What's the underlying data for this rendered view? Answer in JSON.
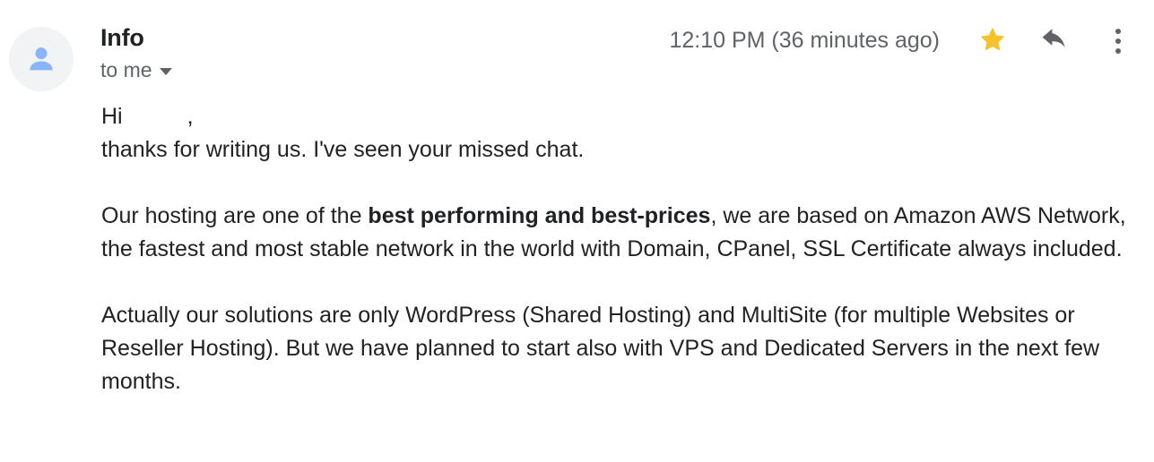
{
  "header": {
    "sender_name": "Info",
    "recipient": "to me",
    "recipient_caret_icon": "chevron-down-icon",
    "timestamp": "12:10 PM (36 minutes ago)",
    "avatar_icon": "person-avatar-icon",
    "actions": {
      "star": {
        "icon": "star-icon",
        "state": "starred",
        "color": "#f4c22b"
      },
      "reply": {
        "icon": "reply-arrow-icon",
        "color": "#5f6368"
      },
      "more": {
        "icon": "more-vertical-icon",
        "color": "#5f6368"
      }
    }
  },
  "message": {
    "greeting_prefix": "Hi",
    "greeting_name_redacted": "",
    "greeting_suffix": ",",
    "line2": "thanks for writing us. I've seen your missed chat.",
    "para2_before_bold": "Our hosting are one of the ",
    "para2_bold": "best performing and best-prices",
    "para2_after_bold": ", we are based on Amazon AWS Network, the fastest and most stable network in the world with Domain, CPanel, SSL Certificate always included.",
    "para3": "Actually our solutions are only WordPress (Shared Hosting) and MultiSite (for multiple Websites or Reseller Hosting). But we have planned to start also with VPS and Dedicated Servers in the next few months."
  }
}
